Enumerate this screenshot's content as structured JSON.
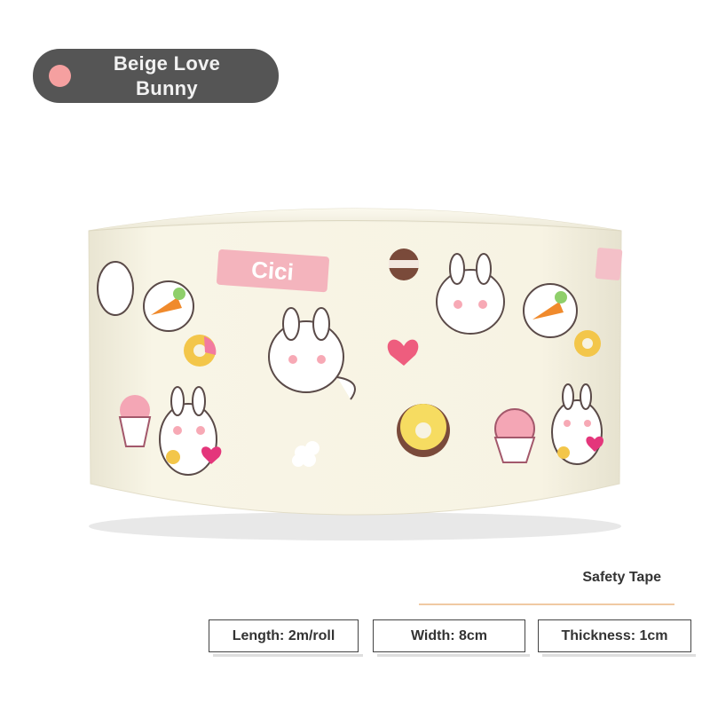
{
  "badge": {
    "label_line1": "Beige Love",
    "label_line2": "Bunny",
    "dot_color": "#f5a0a0",
    "background_color": "#555555"
  },
  "product": {
    "image_icon": "tape-roll-icon",
    "print_text": "Cici",
    "colors": {
      "tape": "#f7f3e2",
      "accent_pink": "#f3a6b7",
      "accent_orange": "#f08a2c"
    }
  },
  "subtitle": "Safety Tape",
  "specs": [
    {
      "label": "Length: 2m/roll"
    },
    {
      "label": "Width: 8cm"
    },
    {
      "label": "Thickness: 1cm"
    }
  ]
}
